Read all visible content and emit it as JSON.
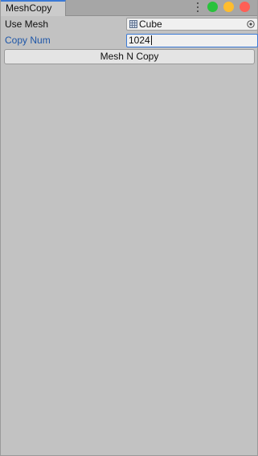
{
  "window": {
    "tab_title": "MeshCopy",
    "controls": {
      "green": "#29c23c",
      "yellow": "#ffbd2e",
      "red": "#ff5f56"
    }
  },
  "form": {
    "use_mesh": {
      "label": "Use Mesh",
      "value": "Cube"
    },
    "copy_num": {
      "label": "Copy Num",
      "value": "1024"
    },
    "button_label": "Mesh N Copy"
  },
  "colors": {
    "accent": "#3a79d6",
    "focused_label": "#1e56a8"
  }
}
